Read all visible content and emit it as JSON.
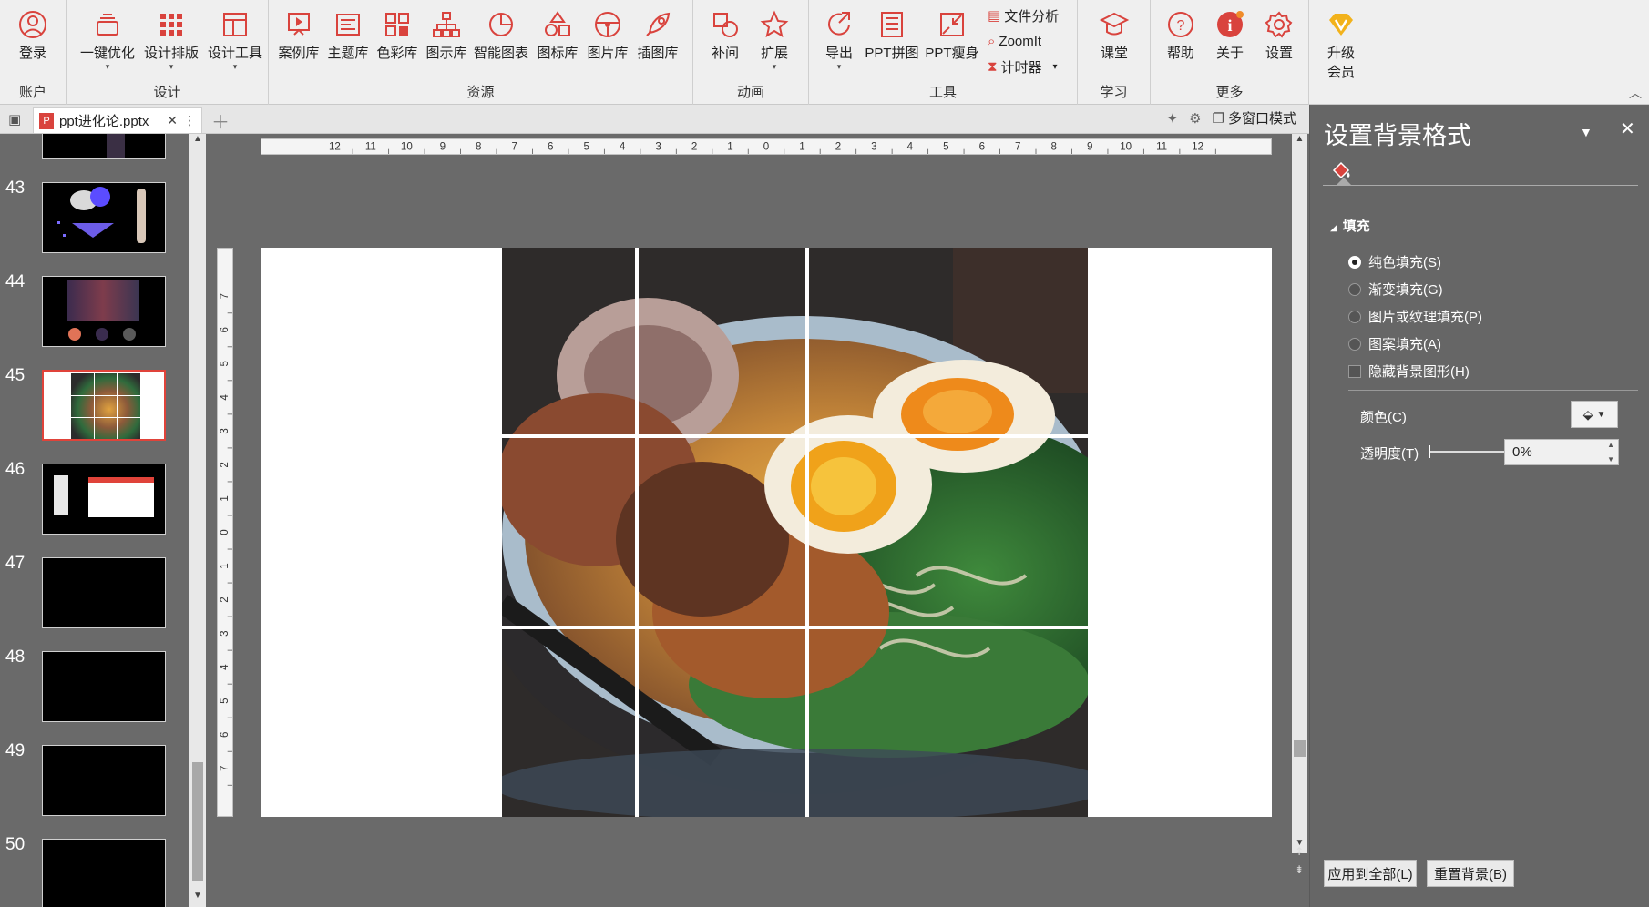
{
  "ribbon": {
    "groups": {
      "account": "账户",
      "design": "设计",
      "resources": "资源",
      "animation": "动画",
      "tools": "工具",
      "learn": "学习",
      "more": "更多"
    },
    "buttons": {
      "login": "登录",
      "one_click_optimize": "一键优化",
      "design_layout": "设计排版",
      "design_tools": "设计工具",
      "case_library": "案例库",
      "theme_library": "主题库",
      "color_library": "色彩库",
      "chart_library": "图示库",
      "smart_chart": "智能图表",
      "icon_library": "图标库",
      "image_library": "图片库",
      "illustration_library": "插图库",
      "tween": "补间",
      "extend": "扩展",
      "export": "导出",
      "ppt_collage": "PPT拼图",
      "ppt_slim": "PPT瘦身",
      "file_analysis": "文件分析",
      "zoomit": "ZoomIt",
      "timer": "计时器",
      "classroom": "课堂",
      "help": "帮助",
      "about": "关于",
      "settings": "设置",
      "upgrade_line1": "升级",
      "upgrade_line2": "会员"
    }
  },
  "tabbar": {
    "filename": "ppt进化论.pptx",
    "multi_window": "多窗口模式"
  },
  "thumbnails": [
    {
      "num": "43"
    },
    {
      "num": "44"
    },
    {
      "num": "45",
      "selected": true
    },
    {
      "num": "46"
    },
    {
      "num": "47"
    },
    {
      "num": "48"
    },
    {
      "num": "49"
    },
    {
      "num": "50"
    }
  ],
  "ruler": {
    "h_ticks": [
      "12",
      "11",
      "10",
      "9",
      "8",
      "7",
      "6",
      "5",
      "4",
      "3",
      "2",
      "1",
      "0",
      "1",
      "2",
      "3",
      "4",
      "5",
      "6",
      "7",
      "8",
      "9",
      "10",
      "11",
      "12"
    ],
    "v_ticks": [
      "7",
      "6",
      "5",
      "4",
      "3",
      "2",
      "1",
      "0",
      "1",
      "2",
      "3",
      "4",
      "5",
      "6",
      "7"
    ]
  },
  "panel": {
    "title": "设置背景格式",
    "section": "填充",
    "options": {
      "solid": "纯色填充(S)",
      "gradient": "渐变填充(G)",
      "picture": "图片或纹理填充(P)",
      "pattern": "图案填充(A)",
      "hide_bg": "隐藏背景图形(H)"
    },
    "color_label": "颜色(C)",
    "transparency_label": "透明度(T)",
    "transparency_value": "0%",
    "apply_all": "应用到全部(L)",
    "reset_bg": "重置背景(B)"
  },
  "colors": {
    "accent": "#d9433d",
    "ribbon_bg": "#efefef",
    "workspace_bg": "#6a6a6a",
    "panel_bg": "#666666"
  }
}
